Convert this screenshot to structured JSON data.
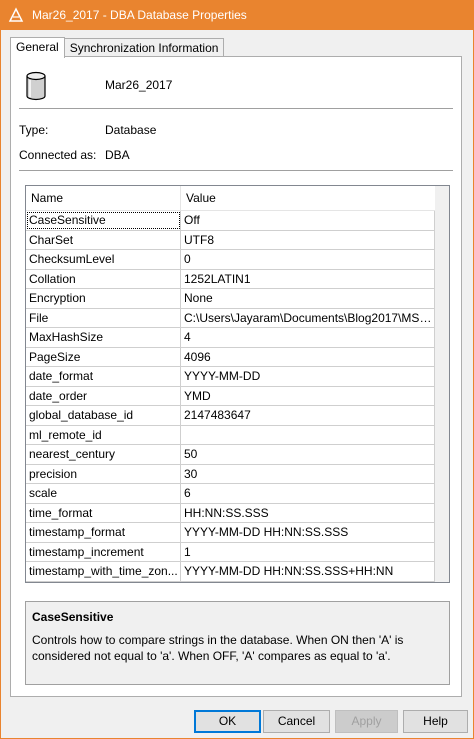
{
  "window": {
    "title": "Mar26_2017 - DBA Database Properties",
    "accent_color": "#e9842f",
    "icon": "sybase-app-icon"
  },
  "tabs": [
    {
      "label": "General",
      "active": true
    },
    {
      "label": "Synchronization Information",
      "active": false
    }
  ],
  "general": {
    "db_icon": "database-cylinder-icon",
    "db_name": "Mar26_2017",
    "type_label": "Type:",
    "type_value": "Database",
    "connected_label": "Connected as:",
    "connected_value": "DBA"
  },
  "grid": {
    "columns": [
      "Name",
      "Value"
    ],
    "rows": [
      {
        "name": "CaseSensitive",
        "value": "Off"
      },
      {
        "name": "CharSet",
        "value": "UTF8"
      },
      {
        "name": "ChecksumLevel",
        "value": "0"
      },
      {
        "name": "Collation",
        "value": "1252LATIN1"
      },
      {
        "name": "Encryption",
        "value": "None"
      },
      {
        "name": "File",
        "value": "C:\\Users\\Jayaram\\Documents\\Blog2017\\MSS..."
      },
      {
        "name": "MaxHashSize",
        "value": "4"
      },
      {
        "name": "PageSize",
        "value": "4096"
      },
      {
        "name": "date_format",
        "value": "YYYY-MM-DD"
      },
      {
        "name": "date_order",
        "value": "YMD"
      },
      {
        "name": "global_database_id",
        "value": "2147483647"
      },
      {
        "name": "ml_remote_id",
        "value": ""
      },
      {
        "name": "nearest_century",
        "value": "50"
      },
      {
        "name": "precision",
        "value": "30"
      },
      {
        "name": "scale",
        "value": "6"
      },
      {
        "name": "time_format",
        "value": "HH:NN:SS.SSS"
      },
      {
        "name": "timestamp_format",
        "value": "YYYY-MM-DD HH:NN:SS.SSS"
      },
      {
        "name": "timestamp_increment",
        "value": "1"
      },
      {
        "name": "timestamp_with_time_zon...",
        "value": "YYYY-MM-DD HH:NN:SS.SSS+HH:NN"
      }
    ],
    "selected_index": 0
  },
  "description": {
    "title": "CaseSensitive",
    "text": "Controls how to compare strings in the database.  When ON then 'A' is considered not equal to 'a'.  When OFF, 'A' compares as equal to 'a'."
  },
  "buttons": {
    "ok": "OK",
    "cancel": "Cancel",
    "apply": "Apply",
    "help": "Help"
  }
}
